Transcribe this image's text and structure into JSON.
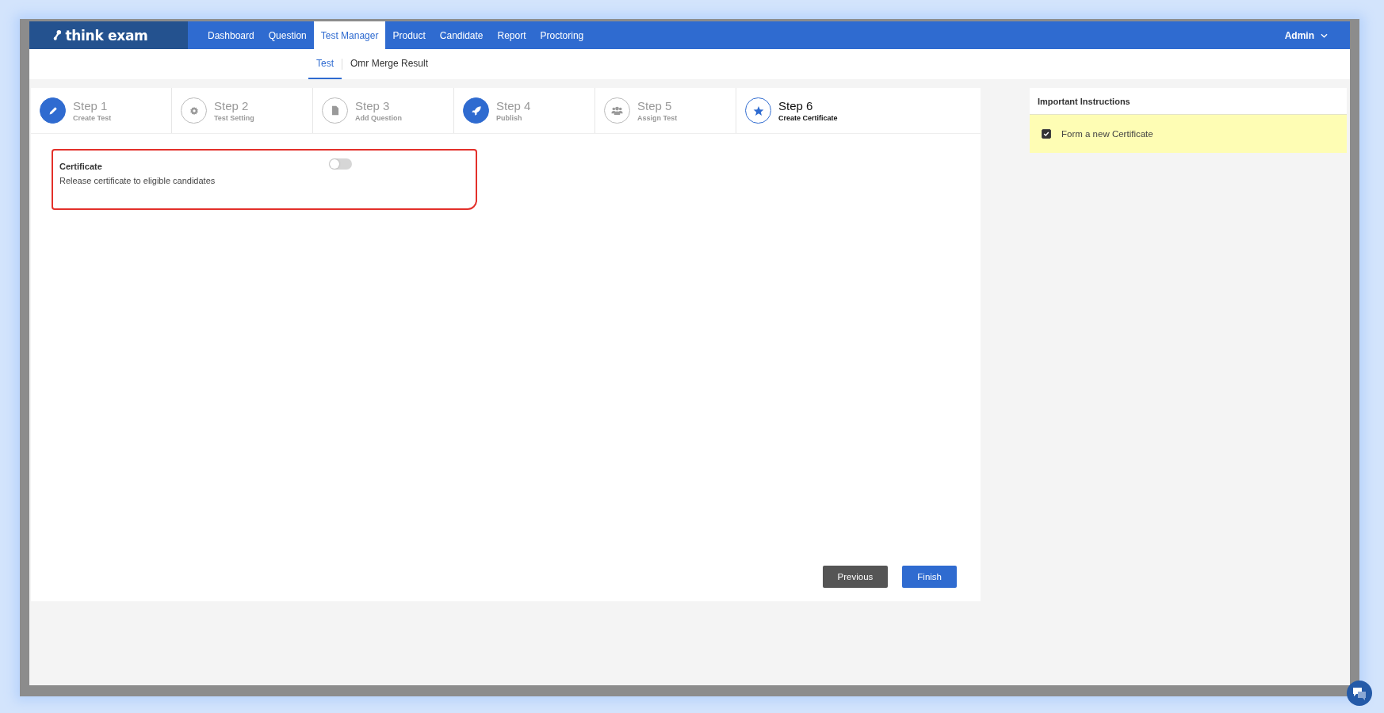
{
  "brand": {
    "name": "think exam"
  },
  "nav": [
    {
      "label": "Dashboard",
      "selected": false
    },
    {
      "label": "Question",
      "selected": false
    },
    {
      "label": "Test Manager",
      "selected": true
    },
    {
      "label": "Product",
      "selected": false
    },
    {
      "label": "Candidate",
      "selected": false
    },
    {
      "label": "Report",
      "selected": false
    },
    {
      "label": "Proctoring",
      "selected": false
    }
  ],
  "user_menu": {
    "label": "Admin"
  },
  "subnav": [
    {
      "label": "Test",
      "selected": true
    },
    {
      "label": "Omr Merge Result",
      "selected": false
    }
  ],
  "steps": [
    {
      "title": "Step 1",
      "subtitle": "Create Test",
      "kind": "done"
    },
    {
      "title": "Step 2",
      "subtitle": "Test Setting",
      "kind": "pending"
    },
    {
      "title": "Step 3",
      "subtitle": "Add Question",
      "kind": "pending"
    },
    {
      "title": "Step 4",
      "subtitle": "Publish",
      "kind": "done"
    },
    {
      "title": "Step 5",
      "subtitle": "Assign Test",
      "kind": "pending"
    },
    {
      "title": "Step 6",
      "subtitle": "Create Certificate",
      "kind": "current"
    }
  ],
  "certificate": {
    "title": "Certificate",
    "description": "Release certificate to eligible candidates",
    "on": false
  },
  "buttons": [
    {
      "label": "Previous",
      "kind": "secondary"
    },
    {
      "label": "Finish",
      "kind": "primary"
    }
  ],
  "instructions": {
    "title": "Important Instructions",
    "items": [
      {
        "label": "Form a new Certificate",
        "checked": true
      }
    ]
  }
}
